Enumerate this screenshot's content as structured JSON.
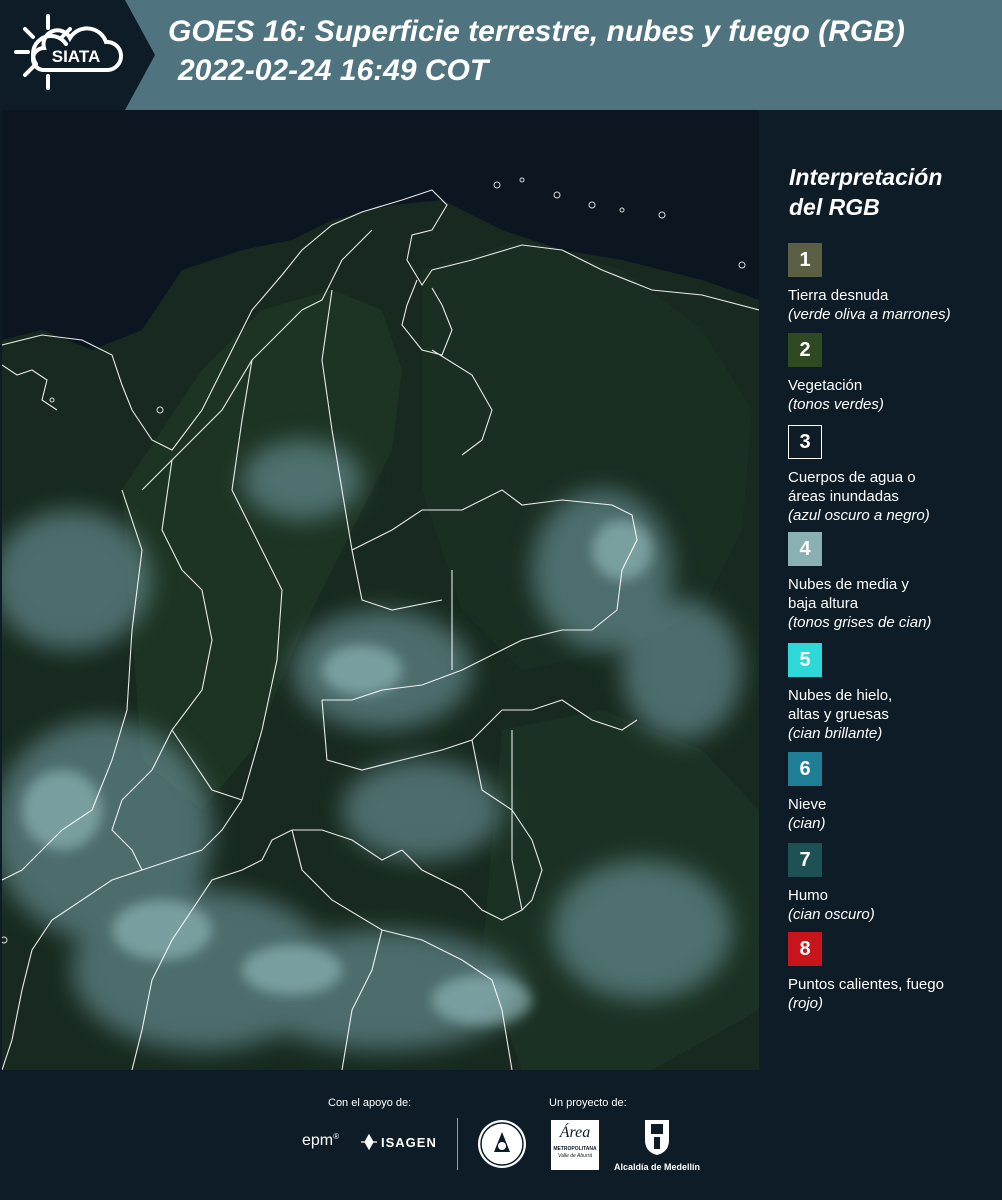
{
  "header": {
    "logo_text": "SIATA",
    "title": "GOES 16: Superficie terrestre, nubes y fuego (RGB)",
    "subtitle": "2022-02-24 16:49 COT"
  },
  "legend": {
    "title_line1": "Interpretación",
    "title_line2": "del RGB",
    "items": [
      {
        "num": "1",
        "color": "#5b5f44",
        "label": [
          "Tierra desnuda"
        ],
        "sub": "(verde oliva a marrones)"
      },
      {
        "num": "2",
        "color": "#2f4a23",
        "label": [
          "Vegetación"
        ],
        "sub": "(tonos verdes)"
      },
      {
        "num": "3",
        "color": "#0d1c26",
        "label": [
          "Cuerpos de agua o",
          "áreas inundadas"
        ],
        "sub": "(azul oscuro a negro)"
      },
      {
        "num": "4",
        "color": "#89b0b2",
        "label": [
          "Nubes de media y",
          "baja altura"
        ],
        "sub": "(tonos grises de cian)"
      },
      {
        "num": "5",
        "color": "#2fd8d8",
        "label": [
          "Nubes de hielo,",
          "altas y gruesas"
        ],
        "sub": "(cian brillante)"
      },
      {
        "num": "6",
        "color": "#1e7e96",
        "label": [
          "Nieve"
        ],
        "sub": "(cian)"
      },
      {
        "num": "7",
        "color": "#1d5153",
        "label": [
          "Humo"
        ],
        "sub": "(cian oscuro)"
      },
      {
        "num": "8",
        "color": "#c8151b",
        "label": [
          "Puntos calientes, fuego"
        ],
        "sub": "(rojo)"
      }
    ]
  },
  "footer": {
    "support_label": "Con el apoyo de:",
    "project_label": "Un proyecto de:",
    "epm": "epm",
    "isagen": "ISAGEN",
    "area_logo": "Área",
    "area_name": "METROPOLITANA",
    "area_sub": "Valle de Aburrá",
    "alcaldia": "Alcaldía de Medellín"
  }
}
